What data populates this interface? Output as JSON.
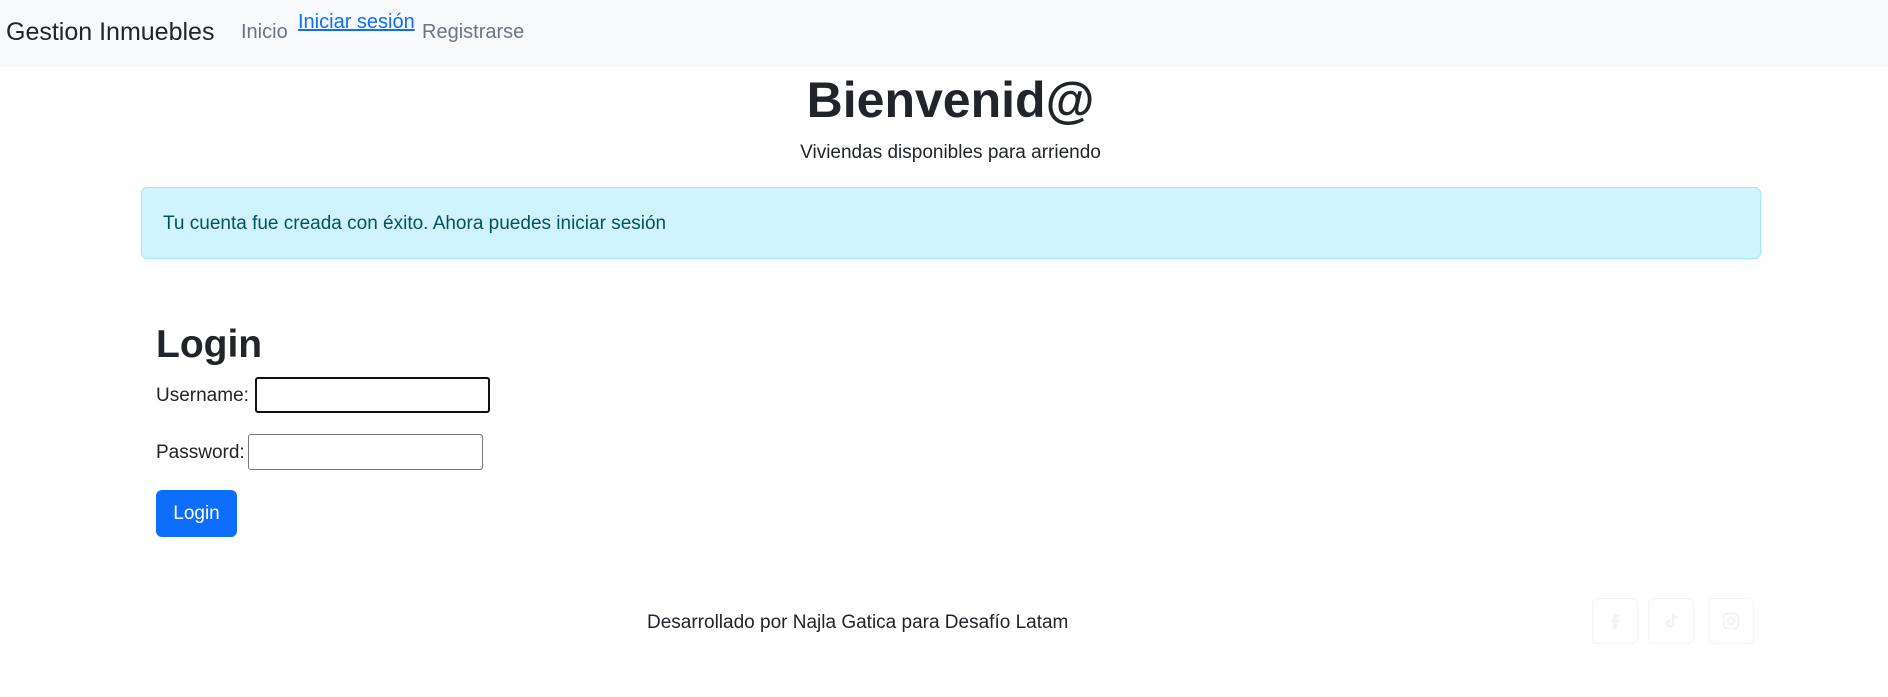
{
  "navbar": {
    "brand": "Gestion Inmuebles",
    "links": [
      {
        "label": "Inicio"
      },
      {
        "label": "Iniciar sesión"
      },
      {
        "label": "Registrarse"
      }
    ]
  },
  "hero": {
    "title": "Bienvenid@",
    "subtitle": "Viviendas disponibles para arriendo"
  },
  "alert": {
    "message": "Tu cuenta fue creada con éxito. Ahora puedes iniciar sesión"
  },
  "login": {
    "title": "Login",
    "username_label": "Username:",
    "username_value": "",
    "password_label": "Password:",
    "password_value": "",
    "submit_label": "Login"
  },
  "footer": {
    "text": "Desarrollado por Najla Gatica para Desafío Latam",
    "social_icons": [
      "facebook-icon",
      "tiktok-icon",
      "instagram-icon"
    ]
  },
  "colors": {
    "navbar_bg": "#f8f9fa",
    "primary": "#0d6efd",
    "alert_bg": "#cff4fc",
    "alert_text": "#055160"
  }
}
